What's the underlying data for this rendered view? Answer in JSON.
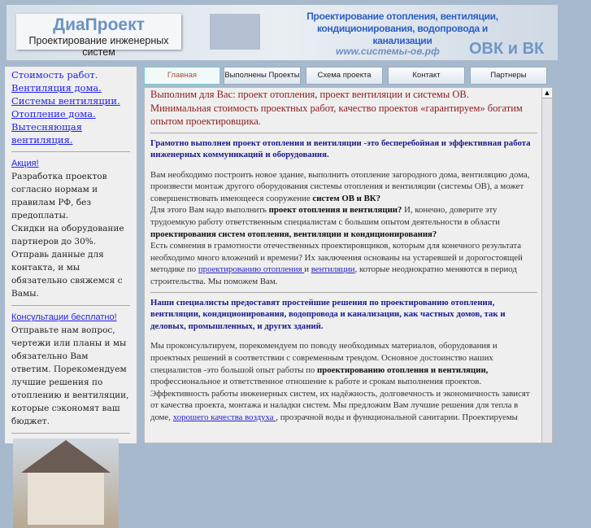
{
  "header": {
    "logo_title": "ДиаПроект",
    "logo_subtitle": "Проектирование инженерных систем",
    "slogan": "Проектирование отопления, вентиляции, кондиционирования, водопровода и канализации",
    "url": "www.системы-ов.рф",
    "brand": "ОВК и ВК"
  },
  "sidebar": {
    "links": [
      "Стоимость работ.",
      "Вентиляция дома.",
      "Системы вентиляции.",
      "Отопление дома.",
      "Вытесняющая вентиляция."
    ],
    "promo_title": "Акция!",
    "promo_text1": "Разработка проектов согласно нормам и правилам РФ, без предоплаты.",
    "promo_text2": "Скидки на оборудование партнеров до 30%. Отправь данные для контакта, и мы обязательно свяжемся с Вамы.",
    "consult_title": "Консультации бесплатно!",
    "consult_text": "Отправьте нам вопрос, чертежи или планы и мы обязательно Вам ответим. Порекомендуем лучшие решения по отоплению и вентиляции, которые сэкономят ваш бюджет."
  },
  "tabs": [
    "Главная",
    "Выполнены Проекты",
    "Схема проекта",
    "Контакт",
    "Партнеры"
  ],
  "content": {
    "intro1": "Выполним для Вас: проект отопления, проект вентиляции и системы ОВ.",
    "intro2": "Минимальная стоимость проектных работ, качество проектов «гарантируем» богатим опытом проектировщика.",
    "lead1": "Грамотно выполнен проект отопления и вентиляции -это бесперебойная и эффективная работа инженерных коммуникаций и оборудования.",
    "p1a": "Вам необходимо построить новое здание, выполнить отопление загородного дома, вентиляцию дома, произвести монтаж другого оборудования системы отопления и вентиляции (системы ОВ), а может совершенствовать имеющееся сооружение ",
    "p1b": "систем ОВ и ВК?",
    "p2a": "Для этого   Вам надо выполнить   ",
    "p2b": "проект отопления и вентиляции?",
    "p2c": "   И, конечно, доверите эту трудоемкую работу ответственным специалистам с большим опытом деятельности в области ",
    "p2d": "проектирования систем отопления, вентиляции и кондиционирования?",
    "p3a": "Есть сомнения в грамотности  отечественных проектировщиков, которым для конечного результата необходимо много вложений и времени? Их заключения основаны на устаревшей и дорогостоящей методике по  ",
    "p3link1": "проектированию отопления ",
    "p3b": " и  ",
    "p3link2": "вентиляции",
    "p3c": ", которые неоднократно меняются в период строительства. Мы поможем Вам.",
    "lead2": "Наши специалисты предоставят простейшие решения по проектированию отопления, вентиляции, кондиционирования, водопровода и канализации, как частных домов, так и деловых, промышленных, и других зданий.",
    "p4a": "Мы проконсультируем, порекомендуем по поводу необходимых материалов, оборудования и проектных решений в соответствии с современным трендом. Основное достоинство наших специалистов  -это большой опыт работы по           ",
    "p4b": "проектированию отопления и вентиляции,",
    "p4c": " профессиональное и ответственное отношение к работе и срокам выполнения проектов. Эффективность работы инженерных систем, их надёжность, долговечность и экономичность зависят от качества проекта, монтажа и наладки систем. Мы предложим Вам лучшие решения для тепла в доме,  ",
    "p4link": "хорошего качества воздуха ",
    "p4d": ", прозрачной воды и функциональной санитарии. Проектируемы"
  }
}
